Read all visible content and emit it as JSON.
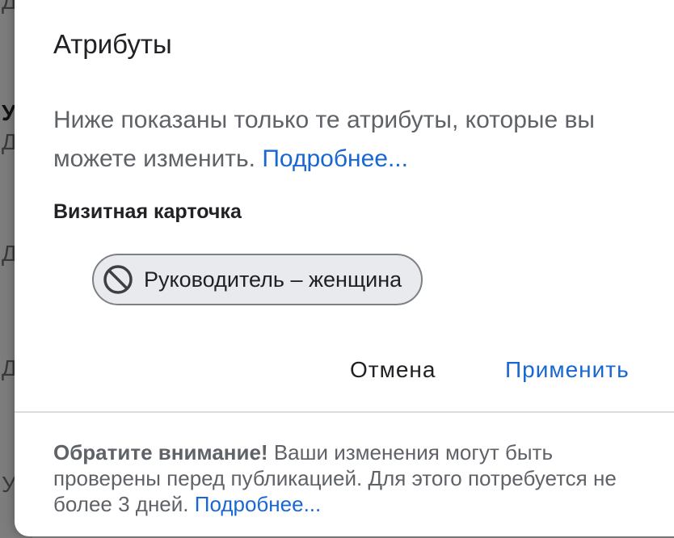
{
  "background": {
    "letters": [
      "Д",
      "У",
      "Д",
      "Д",
      "Д",
      "У"
    ]
  },
  "dialog": {
    "title": "Атрибуты",
    "description": "Ниже показаны только те атрибуты, которые вы можете изменить.",
    "description_link": "Подробнее...",
    "section_label": "Визитная карточка",
    "chip": {
      "icon": "blocked-icon",
      "label": "Руководитель – женщина"
    },
    "actions": {
      "cancel_label": "Отмена",
      "apply_label": "Применить"
    },
    "notice": {
      "bold": "Обратите внимание!",
      "text": "Ваши изменения могут быть проверены перед публикацией. Для этого потребуется не более 3 дней.",
      "link": "Подробнее..."
    }
  },
  "colors": {
    "link": "#1967d2",
    "text_secondary": "#5f6368",
    "chip_bg": "#e8eaed"
  }
}
